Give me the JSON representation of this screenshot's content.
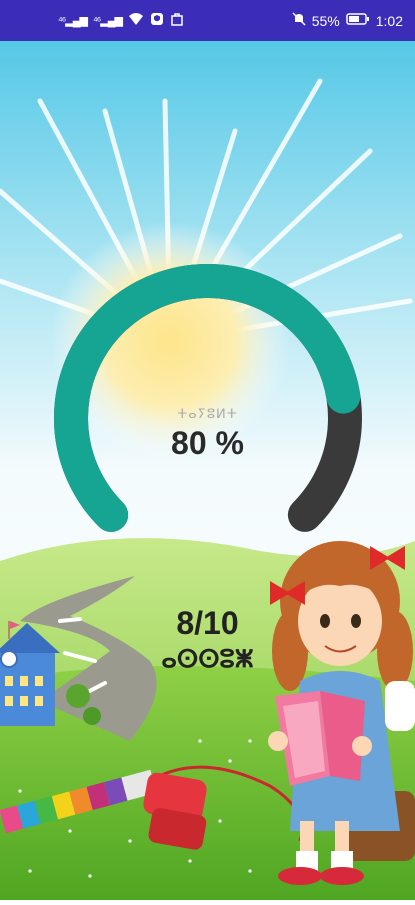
{
  "status_bar": {
    "signal_1": "⁴⁶",
    "signal_2": "⁴⁶",
    "battery_pct": "55%",
    "time": "1:02"
  },
  "gauge": {
    "label": "ⵜⴰⵢⵓⵍⵜ",
    "value_text": "80 %",
    "percent": 0.8,
    "track_color": "#3a3a3a",
    "fill_color": "#17a593"
  },
  "score": {
    "value": "8/10",
    "label": "ⴰⵙⵙⵓⵥ"
  }
}
